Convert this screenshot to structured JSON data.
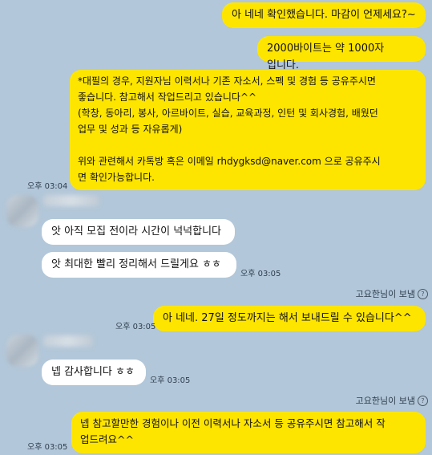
{
  "messages": [
    {
      "side": "me",
      "text": "아 네네 확인했습니다. 마감이 언제세요?~"
    },
    {
      "side": "me",
      "text": "2000바이트는 약 1000자 입니다."
    },
    {
      "side": "me",
      "text": "*대필의 경우, 지원자님 이력서나 기존 자소서, 스펙 및 경험 등 공유주시면\n좋습니다. 참고해서 작업드리고 있습니다^^\n(학창, 동아리, 봉사, 아르바이트, 실습, 교육과정, 인턴 및 회사경험, 배웠던\n업무 및 성과 등 자유롭게)\n\n위와 관련해서 카톡방 혹은 이메일 rhdygksd@naver.com 으로 공유주시\n면 확인가능합니다.",
      "time": "오후 03:04"
    },
    {
      "side": "other",
      "text": "앗 아직 모집 전이라 시간이 넉넉합니다"
    },
    {
      "side": "other",
      "text": "앗 최대한 빨리 정리해서 드릴게요 ㅎㅎ",
      "time": "오후 03:05"
    },
    {
      "side": "me",
      "sent_by": "고요한님이 보냄",
      "text": "아 네네. 27일 정도까지는 해서 보내드릴 수 있습니다^^",
      "time": "오후 03:05"
    },
    {
      "side": "other",
      "text": "넵 감사합니다 ㅎㅎ",
      "time": "오후 03:05"
    },
    {
      "side": "me",
      "sent_by": "고요한님이 보냄",
      "text": "넵 참고할만한 경험이나 이전 이력서나 자소서 등 공유주시면 참고해서 작\n업드려요^^",
      "time": "오후 03:05"
    }
  ],
  "icons": {
    "help": "question-circle-icon"
  },
  "colors": {
    "background": "#b2c7d9",
    "my_bubble": "#fee500",
    "other_bubble": "#ffffff"
  }
}
